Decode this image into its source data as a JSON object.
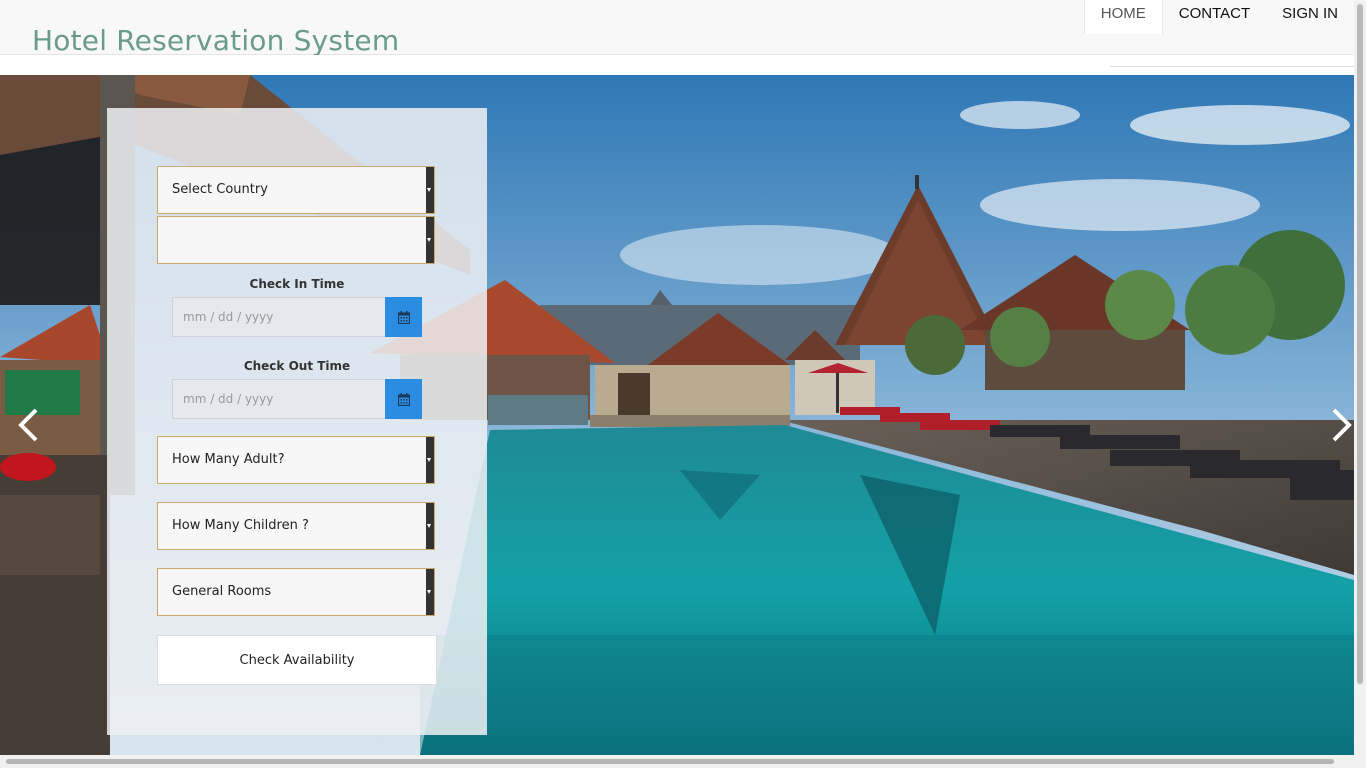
{
  "header": {
    "brand": "Hotel Reservation System",
    "nav": [
      {
        "label": "HOME",
        "active": true
      },
      {
        "label": "CONTACT",
        "active": false
      },
      {
        "label": "SIGN IN",
        "active": false
      }
    ]
  },
  "form": {
    "country": "Select Country",
    "city": "",
    "check_in_label": "Check In Time",
    "check_in_placeholder": "mm / dd / yyyy",
    "check_out_label": "Check Out Time",
    "check_out_placeholder": "mm / dd / yyyy",
    "adults": "How Many Adult?",
    "children": "How Many Children ?",
    "room_type": "General Rooms",
    "submit": "Check Availability"
  },
  "carousel": {
    "prev_icon": "chevron-left-icon",
    "next_icon": "chevron-right-icon"
  },
  "colors": {
    "brand": "#6a9b8c",
    "calendar_button": "#2b8de2",
    "select_border": "#c9a86b"
  }
}
